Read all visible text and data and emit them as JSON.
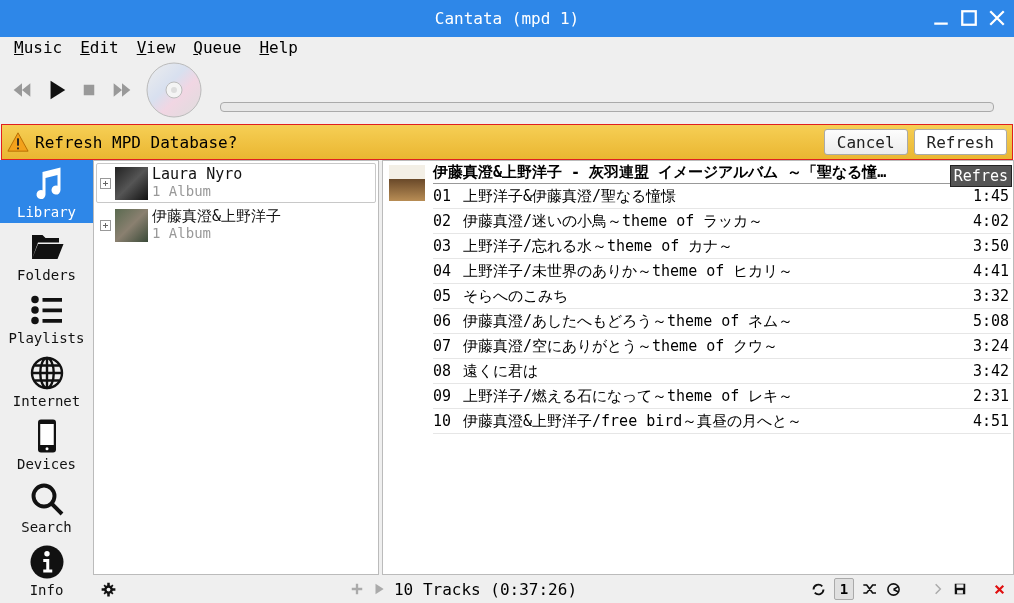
{
  "window": {
    "title": "Cantata (mpd 1)"
  },
  "menu": [
    "Music",
    "Edit",
    "View",
    "Queue",
    "Help"
  ],
  "playback": {
    "level": 0
  },
  "notification": {
    "message": "Refresh MPD Database?",
    "buttons": [
      {
        "label": "Cancel",
        "hovered": false
      },
      {
        "label": "Refresh",
        "hovered": true
      }
    ],
    "tooltip": "Refres"
  },
  "sidebar": [
    {
      "label": "Library",
      "selected": true
    },
    {
      "label": "Folders",
      "selected": false
    },
    {
      "label": "Playlists",
      "selected": false
    },
    {
      "label": "Internet",
      "selected": false
    },
    {
      "label": "Devices",
      "selected": false
    },
    {
      "label": "Search",
      "selected": false
    },
    {
      "label": "Info",
      "selected": false
    }
  ],
  "artists": [
    {
      "name": "Laura Nyro",
      "count": "1 Album",
      "selected": true
    },
    {
      "name": "伊藤真澄&上野洋子",
      "count": "1 Album",
      "selected": false
    }
  ],
  "album_header": "伊藤真澄&上野洋子 - 灰羽連盟 イメージアルバム ～「聖なる憧…",
  "tracks": [
    {
      "number": "01",
      "title": "上野洋子&伊藤真澄/聖なる憧憬",
      "duration": "1:45"
    },
    {
      "number": "02",
      "title": "伊藤真澄/迷いの小鳥～theme of ラッカ～",
      "duration": "4:02"
    },
    {
      "number": "03",
      "title": "上野洋子/忘れる水～theme of カナ～",
      "duration": "3:50"
    },
    {
      "number": "04",
      "title": "上野洋子/未世界のありか～theme of ヒカリ～",
      "duration": "4:41"
    },
    {
      "number": "05",
      "title": "そらへのこみち",
      "duration": "3:32"
    },
    {
      "number": "06",
      "title": "伊藤真澄/あしたへもどろう～theme of ネム～",
      "duration": "5:08"
    },
    {
      "number": "07",
      "title": "伊藤真澄/空にありがとう～theme of クウ～",
      "duration": "3:24"
    },
    {
      "number": "08",
      "title": "遠くに君は",
      "duration": "3:42"
    },
    {
      "number": "09",
      "title": "上野洋子/燃える石になって～theme of レキ～",
      "duration": "2:31"
    },
    {
      "number": "10",
      "title": "伊藤真澄&上野洋子/free bird～真昼の月へと～",
      "duration": "4:51"
    }
  ],
  "status_bar": {
    "summary": "10 Tracks (0:37:26)",
    "single_label": "1",
    "single_on": true
  }
}
